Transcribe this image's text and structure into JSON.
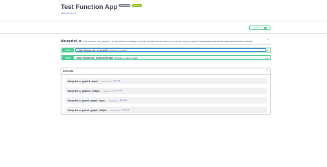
{
  "info": {
    "title": "Test Function App",
    "version_badge": "1.0.0-beta",
    "oas_badge": "OAS 3.0",
    "spec_link": "/api/openapi.json"
  },
  "auth": {
    "label": "Authorize"
  },
  "tag": {
    "name": "blueprint_a",
    "description": "This blueprint, \"test_blueprint\", is responsible for handling core graph operations in the testing environment. It groups together related graphs and defines shared authentication methods."
  },
  "operations": [
    {
      "method": "POST",
      "path": "/api/blueprint_a/graphA",
      "summary": "blueprint_a_graphA"
    },
    {
      "method": "POST",
      "path": "/api/blueprint_a/parentGraph",
      "summary": "blueprint_a_parent_graph"
    }
  ],
  "schemas": {
    "title": "Schemas",
    "models": [
      {
        "name": "blueprint_a_graphA_Input",
        "arrow": "›",
        "expand": "Expand all",
        "type": "object"
      },
      {
        "name": "blueprint_a_graphA_Output",
        "arrow": "›",
        "expand": "Expand all",
        "type": "object"
      },
      {
        "name": "blueprint_a_parent_graph_Input",
        "arrow": "›",
        "expand": "Expand all",
        "type": "object"
      },
      {
        "name": "blueprint_a_parent_graph_Output",
        "arrow": "›",
        "expand": "Expand all",
        "type": "object"
      }
    ]
  },
  "colors": {
    "post": "#49cc90",
    "link": "#4990e2",
    "text": "#3b4151"
  }
}
